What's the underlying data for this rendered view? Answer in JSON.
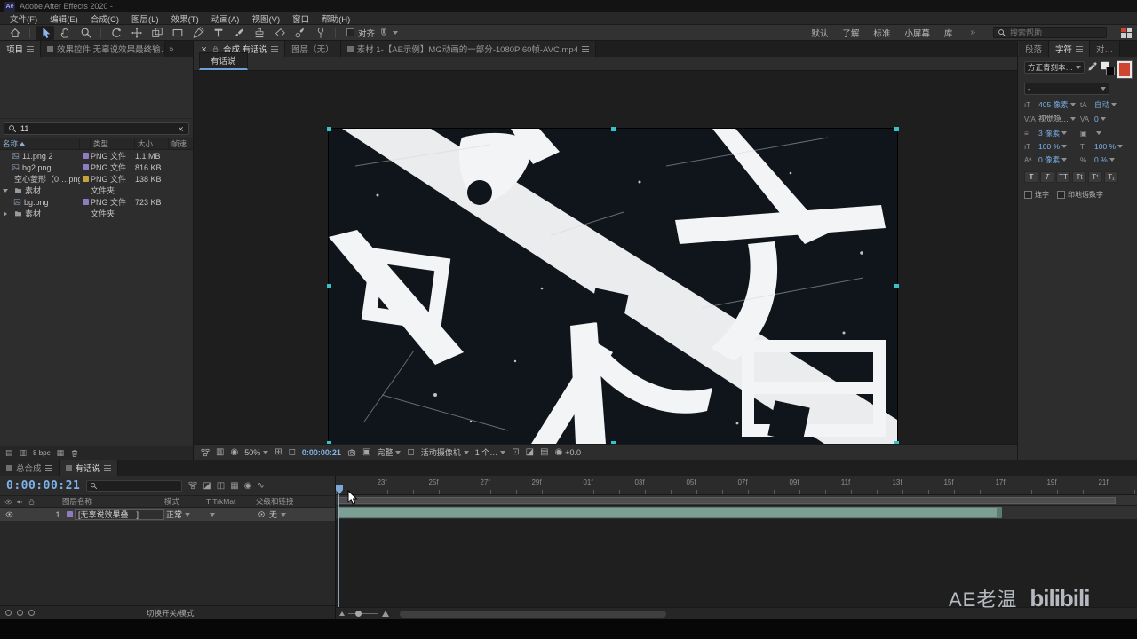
{
  "colors": {
    "accent_blue": "#7ab0e8",
    "timecode_blue": "#7eb2e8",
    "layer_bar_green": "#7d9e94",
    "label_violet": "#8f7bc0",
    "label_yellow": "#c8a23c",
    "handle_cyan": "#38c2c8",
    "panel_bg": "#2d2d2d"
  },
  "titlebar": {
    "app_icon": "Ae",
    "title": "Adobe After Effects 2020 -"
  },
  "menubar": {
    "items": [
      "文件(F)",
      "编辑(E)",
      "合成(C)",
      "图层(L)",
      "效果(T)",
      "动画(A)",
      "视图(V)",
      "窗口",
      "帮助(H)"
    ]
  },
  "toolbar": {
    "align_label": "对齐",
    "workspaces": [
      "默认",
      "了解",
      "标准",
      "小屏幕",
      "库"
    ],
    "overflow": "»",
    "search_placeholder": "搜索帮助"
  },
  "project": {
    "tab_project": "项目",
    "tab_effect_controls": "效果控件 无辜说效果最终输…",
    "overflow": "»",
    "search_value": "11",
    "columns": {
      "name": "名称",
      "type": "类型",
      "size": "大小",
      "fps": "帧速"
    },
    "rows": [
      {
        "name": "11.png 2",
        "type": "PNG 文件",
        "size": "1.1 MB"
      },
      {
        "name": "bg2.png",
        "type": "PNG 文件",
        "size": "816 KB"
      },
      {
        "name": "空心菱形（0….png",
        "type": "PNG 文件",
        "size": "138 KB"
      },
      {
        "name": "素材",
        "type": "文件夹",
        "size": ""
      },
      {
        "name": "bg.png",
        "type": "PNG 文件",
        "size": "723 KB"
      },
      {
        "name": "素材",
        "type": "文件夹",
        "size": ""
      }
    ],
    "bpc": "8 bpc"
  },
  "comp": {
    "tab_composition": "合成 有话说",
    "tab_layer": "图层（无）",
    "tab_footage": "素材 1-【AE示例】MG动画的一部分-1080P 60帧-AVC.mp4",
    "viewer_tab": "有话说",
    "zoom": "50%",
    "timecode": "0:00:00:21",
    "resolution": "完整",
    "camera_view": "活动摄像机",
    "view_layout": "1 个…",
    "exposure": "+0.0"
  },
  "character": {
    "tab_paragraph": "段落",
    "tab_character": "字符",
    "tab_align": "对…",
    "font_family": "方正青刻本…",
    "font_style": "-",
    "font_size": "405 像素",
    "leading": "自动",
    "kerning": "视觉隐…",
    "tracking": "0",
    "stroke_width": "3 像素",
    "vertical_scale": "100 %",
    "horizontal_scale": "100 %",
    "baseline_shift": "0 像素",
    "tsume": "0 %",
    "faux": [
      "T",
      "T",
      "TT",
      "Tt",
      "T¹",
      "T₁"
    ],
    "ligatures_label": "连字",
    "hindi_label": "印地语数字"
  },
  "timeline": {
    "tab_main": "总合成",
    "tab_active": "有话说",
    "timecode": "0:00:00:21",
    "columns": {
      "layer_name": "图层名称",
      "mode": "模式",
      "trkmat": "T TrkMat",
      "parent": "父级和链接"
    },
    "layer": {
      "index": "1",
      "name": "[无辜说效果叠…]",
      "mode": "正常",
      "parent": "无"
    },
    "ruler_ticks": [
      "23f",
      "25f",
      "27f",
      "29f",
      "01f",
      "03f",
      "05f",
      "07f",
      "09f",
      "11f",
      "13f",
      "15f",
      "17f",
      "19f",
      "21f"
    ],
    "status_hint": "切换开关/模式"
  },
  "watermark": {
    "text": "AE老温",
    "logo": "bilibili"
  }
}
